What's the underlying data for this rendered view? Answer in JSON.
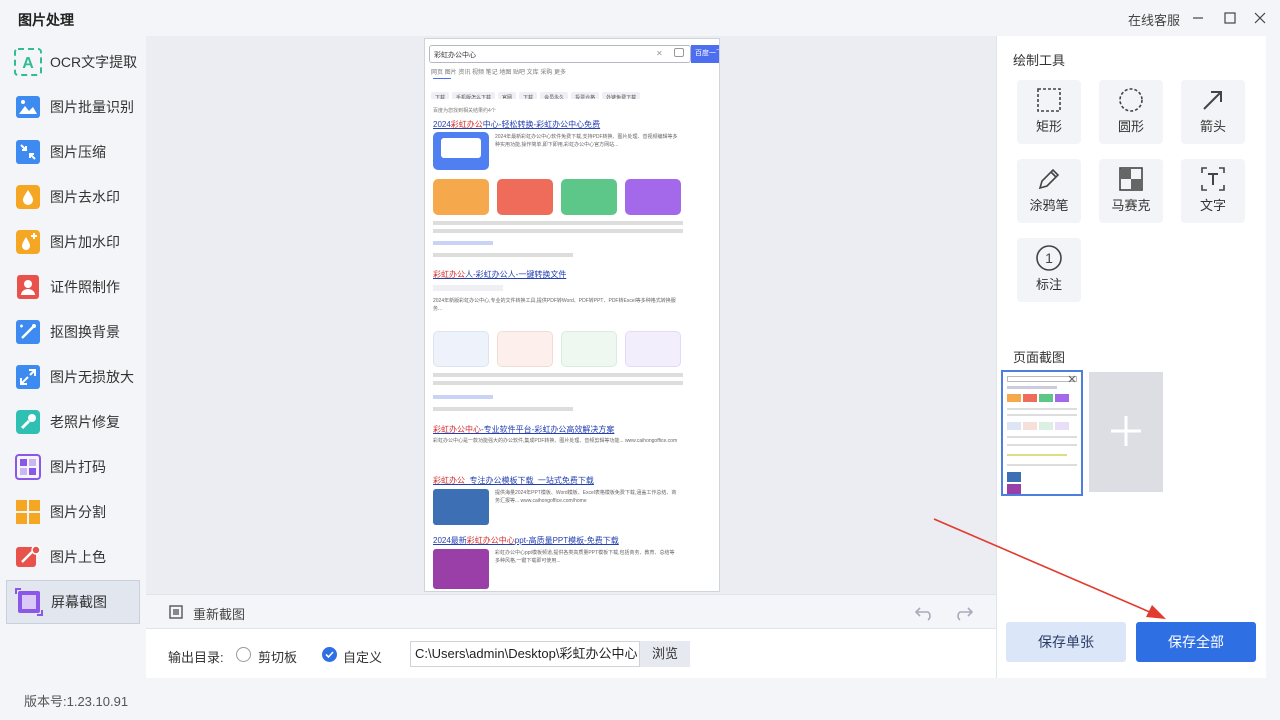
{
  "app": {
    "title": "图片处理",
    "service": "在线客服",
    "version": "版本号:1.23.10.91"
  },
  "sidebar": {
    "items": [
      {
        "label": "OCR文字提取",
        "icon": "ocr-icon",
        "color": "#2fbf8f"
      },
      {
        "label": "图片批量识别",
        "icon": "image-batch-icon",
        "color": "#3d8af0"
      },
      {
        "label": "图片压缩",
        "icon": "compress-icon",
        "color": "#3d8af0"
      },
      {
        "label": "图片去水印",
        "icon": "remove-watermark-icon",
        "color": "#f5a623"
      },
      {
        "label": "图片加水印",
        "icon": "add-watermark-icon",
        "color": "#f5a623"
      },
      {
        "label": "证件照制作",
        "icon": "id-photo-icon",
        "color": "#e8524a"
      },
      {
        "label": "抠图换背景",
        "icon": "cutout-icon",
        "color": "#3d8af0"
      },
      {
        "label": "图片无损放大",
        "icon": "enlarge-icon",
        "color": "#3d8af0"
      },
      {
        "label": "老照片修复",
        "icon": "photo-repair-icon",
        "color": "#2fbfb3"
      },
      {
        "label": "图片打码",
        "icon": "mosaic-icon",
        "color": "#8b57e8"
      },
      {
        "label": "图片分割",
        "icon": "split-icon",
        "color": "#f5a623"
      },
      {
        "label": "图片上色",
        "icon": "colorize-icon",
        "color": "#e8524a"
      },
      {
        "label": "屏幕截图",
        "icon": "screenshot-icon",
        "color": "#8b57e8"
      }
    ],
    "active_index": 12
  },
  "toolbar": {
    "recapture_label": "重新截图"
  },
  "output": {
    "dir_label": "输出目录:",
    "option_clipboard": "剪切板",
    "option_custom": "自定义",
    "selected": "自定义",
    "path_value": "C:\\Users\\admin\\Desktop\\彩虹办公中心",
    "browse_label": "浏览"
  },
  "tools_panel": {
    "title": "绘制工具",
    "tools": [
      {
        "label": "矩形",
        "icon": "rectangle-icon"
      },
      {
        "label": "圆形",
        "icon": "circle-icon"
      },
      {
        "label": "箭头",
        "icon": "arrow-icon"
      },
      {
        "label": "涂鸦笔",
        "icon": "pen-icon"
      },
      {
        "label": "马赛克",
        "icon": "mosaic-tool-icon"
      },
      {
        "label": "文字",
        "icon": "text-icon"
      },
      {
        "label": "标注",
        "icon": "number-marker-icon"
      }
    ]
  },
  "screenshots_panel": {
    "title": "页面截图"
  },
  "actions": {
    "save_one": "保存单张",
    "save_all": "保存全部"
  },
  "preview": {
    "search_query": "彩虹办公中心",
    "search_button": "百度一下",
    "tabs": "网页 图片 资讯 视频 笔记 地图 贴吧 文库 采购 更多",
    "chips": [
      "下载",
      "手机版怎么下载",
      "官网",
      "下载",
      "会员永久",
      "投票合格",
      "外链免费下载"
    ],
    "result_count": "百度为您找到相关结果约4个",
    "results": [
      {
        "title_pre": "2024",
        "title_hl": "彩虹办公",
        "title_post": "中心-轻松转换-彩虹办公中心免费",
        "desc": "2024年最新彩虹办公中心软件免费下载,支持PDF转换、图片处理、音视频编辑等多种实用功能,操作简单,即下即用,彩虹办公中心官方网站..."
      },
      {
        "title_pre": "",
        "title_hl": "彩虹办公",
        "title_post": "人-彩虹办公人-一键转换文件",
        "desc": "2024年新版彩虹办公中心,专业的文件转换工具,提供PDF转Word、PDF转PPT、PDF转Excel等多种格式转换服务..."
      },
      {
        "title_pre": "",
        "title_hl": "彩虹办公中心",
        "title_post": "-专业软件平台-彩虹办公高效解决方案",
        "desc": "彩虹办公中心是一款功能强大的办公软件,集成PDF转换、图片处理、音频剪辑等功能... www.caihongoffice.com"
      },
      {
        "title_pre": "",
        "title_hl": "彩虹办公",
        "title_post": "_专注办公模板下载_一站式免费下载",
        "desc": "提供海量2024年PPT模板、Word模板、Excel表格模板免费下载,涵盖工作总结、商务汇报等... www.caihongoffice.com/home"
      },
      {
        "title_pre": "2024最新",
        "title_hl": "彩虹办公中心",
        "title_post": "ppt-高质量PPT模板-免费下载",
        "desc": "彩虹办公中心ppt模板频道,提供各类高质量PPT模板下载,包括商务、教育、总结等多种风格,一键下载即可使用..."
      }
    ]
  }
}
